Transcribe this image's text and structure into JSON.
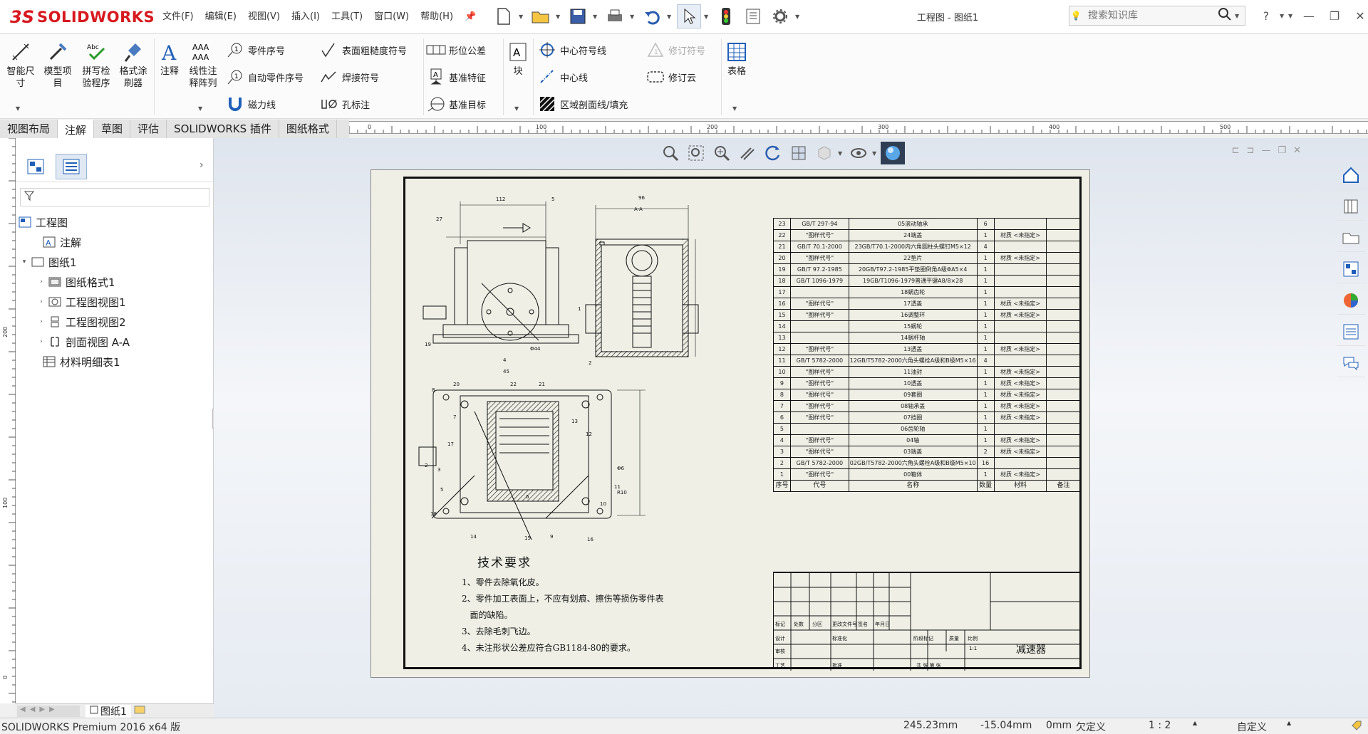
{
  "app": {
    "brand_prefix": "3S",
    "brand": "SOLIDWORKS",
    "title": "工程图 - 图纸1",
    "menus": [
      "文件(F)",
      "编辑(E)",
      "视图(V)",
      "插入(I)",
      "工具(T)",
      "窗口(W)",
      "帮助(H)"
    ],
    "search_placeholder": "搜索知识库"
  },
  "ribbon": {
    "smart_dim": "智能尺寸",
    "model_items": "模型项目",
    "spell_check": "拼写检验程序",
    "format_painter": "格式涂刷器",
    "note": "注释",
    "linear_pattern": "线性注释阵列",
    "balloon": "零件序号",
    "auto_balloon": "自动零件序号",
    "magnetic_line": "磁力线",
    "surface_finish": "表面粗糙度符号",
    "weld_symbol": "焊接符号",
    "hole_callout": "孔标注",
    "gtol": "形位公差",
    "datum_feature": "基准特征",
    "datum_target": "基准目标",
    "block": "块",
    "center_mark": "中心符号线",
    "centerline": "中心线",
    "hatch": "区域剖面线/填充",
    "revision_symbol": "修订符号",
    "revision_cloud": "修订云",
    "tables": "表格"
  },
  "tabs": [
    "视图布局",
    "注解",
    "草图",
    "评估",
    "SOLIDWORKS 插件",
    "图纸格式"
  ],
  "active_tab": "注解",
  "ruler": {
    "h_ticks": [
      "0",
      "100",
      "200",
      "300",
      "400",
      "500"
    ],
    "v_ticks": [
      "200",
      "100",
      "0"
    ]
  },
  "tree": {
    "root": "工程图",
    "items": [
      {
        "label": "注解",
        "level": 1,
        "expander": ""
      },
      {
        "label": "图纸1",
        "level": 0,
        "expander": "▾"
      },
      {
        "label": "图纸格式1",
        "level": 2,
        "expander": "›"
      },
      {
        "label": "工程图视图1",
        "level": 2,
        "expander": "›"
      },
      {
        "label": "工程图视图2",
        "level": 2,
        "expander": "›"
      },
      {
        "label": "剖面视图 A-A",
        "level": 2,
        "expander": "›"
      },
      {
        "label": "材料明细表1",
        "level": 1,
        "expander": ""
      }
    ]
  },
  "sheet_tab": "图纸1",
  "bom": {
    "rows": [
      [
        "23",
        "GB/T 297-94",
        "05滚动轴承",
        "6",
        "",
        ""
      ],
      [
        "22",
        "\"图样代号\"",
        "24端盖",
        "1",
        "材质 <未指定>",
        ""
      ],
      [
        "21",
        "GB/T 70.1-2000",
        "23GB/T70.1-2000内六角圆柱头螺钉M5×12",
        "4",
        "",
        ""
      ],
      [
        "20",
        "\"图样代号\"",
        "22垫片",
        "1",
        "材质 <未指定>",
        ""
      ],
      [
        "19",
        "GB/T 97.2-1985",
        "20GB/T97.2-1985平垫圈倒角A级ΦA5×4",
        "1",
        "",
        ""
      ],
      [
        "18",
        "GB/T 1096-1979",
        "19GB/T1096-1979普通平键A8/8×28",
        "1",
        "",
        ""
      ],
      [
        "17",
        "",
        "18蜗齿轮",
        "1",
        "",
        ""
      ],
      [
        "16",
        "\"图样代号\"",
        "17透盖",
        "1",
        "材质 <未指定>",
        ""
      ],
      [
        "15",
        "\"图样代号\"",
        "16调整环",
        "1",
        "材质 <未指定>",
        ""
      ],
      [
        "14",
        "",
        "15蜗轮",
        "1",
        "",
        ""
      ],
      [
        "13",
        "",
        "14蜗杆轴",
        "1",
        "",
        ""
      ],
      [
        "12",
        "\"图样代号\"",
        "13透盖",
        "1",
        "材质 <未指定>",
        ""
      ],
      [
        "11",
        "GB/T 5782-2000",
        "12GB/T5782-2000六角头螺栓A级和B级M5×16",
        "4",
        "",
        ""
      ],
      [
        "10",
        "\"图样代号\"",
        "11油封",
        "1",
        "材质 <未指定>",
        ""
      ],
      [
        "9",
        "\"图样代号\"",
        "10透盖",
        "1",
        "材质 <未指定>",
        ""
      ],
      [
        "8",
        "\"图样代号\"",
        "09套圈",
        "1",
        "材质 <未指定>",
        ""
      ],
      [
        "7",
        "\"图样代号\"",
        "08轴承盖",
        "1",
        "材质 <未指定>",
        ""
      ],
      [
        "6",
        "\"图样代号\"",
        "07挡圈",
        "1",
        "材质 <未指定>",
        ""
      ],
      [
        "5",
        "",
        "06齿轮轴",
        "1",
        "",
        ""
      ],
      [
        "4",
        "\"图样代号\"",
        "04轴",
        "1",
        "材质 <未指定>",
        ""
      ],
      [
        "3",
        "\"图样代号\"",
        "03端盖",
        "2",
        "材质 <未指定>",
        ""
      ],
      [
        "2",
        "GB/T 5782-2000",
        "02GB/T5782-2000六角头螺栓A级和B级M5×10",
        "16",
        "",
        ""
      ],
      [
        "1",
        "\"图样代号\"",
        "00箱体",
        "1",
        "材质 <未指定>",
        ""
      ]
    ],
    "header": [
      "序号",
      "代号",
      "名称",
      "数量",
      "材料",
      "备注"
    ]
  },
  "title_block": {
    "name": "减速器",
    "labels": [
      "标记",
      "处数",
      "分区",
      "更改文件号",
      "签名",
      "年月日",
      "设计",
      "标准化",
      "审核",
      "工艺",
      "批准",
      "阶段标记",
      "质量",
      "比例",
      "共 张 第 张"
    ],
    "scale": "1:1"
  },
  "tech": {
    "title": "技术要求",
    "lines": [
      "1、零件去除氧化皮。",
      "2、零件加工表面上，不应有划痕、擦伤等损伤零件表",
      "   面的缺陷。",
      "3、去除毛刺飞边。",
      "4、未注形状公差应符合GB1184-80的要求。"
    ]
  },
  "dims": {
    "d112": "112",
    "d5": "5",
    "d96": "96",
    "dAA": "A-A",
    "d27": "27",
    "dphi44": "Φ44",
    "d45": "45",
    "d2": "2",
    "dphi6": "Φ6",
    "dR10": "R10",
    "balloons": [
      "1",
      "2",
      "3",
      "4",
      "5",
      "6",
      "7",
      "8",
      "9",
      "10",
      "11",
      "12",
      "13",
      "14",
      "15",
      "16",
      "17",
      "18",
      "19",
      "20",
      "21",
      "22"
    ]
  },
  "status": {
    "product": "SOLIDWORKS Premium 2016 x64 版",
    "x": "245.23mm",
    "y": "-15.04mm",
    "z": "0mm",
    "state": "欠定义",
    "scale": "1 : 2",
    "units": "自定义"
  }
}
